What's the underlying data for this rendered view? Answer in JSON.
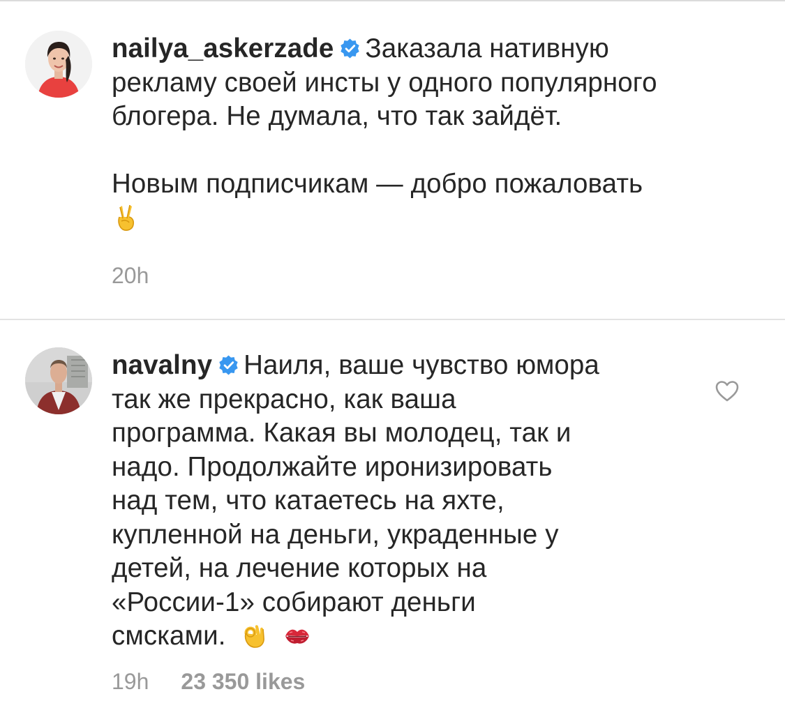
{
  "comments": [
    {
      "username": "nailya_askerzade",
      "verified": true,
      "lines": [
        "Заказала нативную",
        "рекламу своей инсты у одного популярного",
        "блогера. Не думала, что так зайдёт."
      ],
      "lines2": [
        "Новым подписчикам — добро пожаловать"
      ],
      "emoji": "victory-hand",
      "time": "20h"
    },
    {
      "username": "navalny",
      "verified": true,
      "lines": [
        "Наиля, ваше чувство юмора",
        "так же прекрасно, как ваша",
        "программа. Какая вы молодец, так и",
        "надо. Продолжайте иронизировать",
        "над тем, что катаетесь на яхте,",
        "купленной на деньги, украденные у",
        "детей, на лечение которых на",
        "«России-1» собирают деньги",
        "смсками."
      ],
      "emojis": [
        "ok-hand",
        "kiss-mark"
      ],
      "time": "19h",
      "likes": "23 350 likes"
    }
  ],
  "colors": {
    "text": "#262626",
    "meta": "#999999",
    "verified": "#3897f0",
    "divider": "#e3e3e3"
  },
  "icons": {
    "verified": "verified-badge-icon",
    "like": "heart-outline-icon"
  }
}
